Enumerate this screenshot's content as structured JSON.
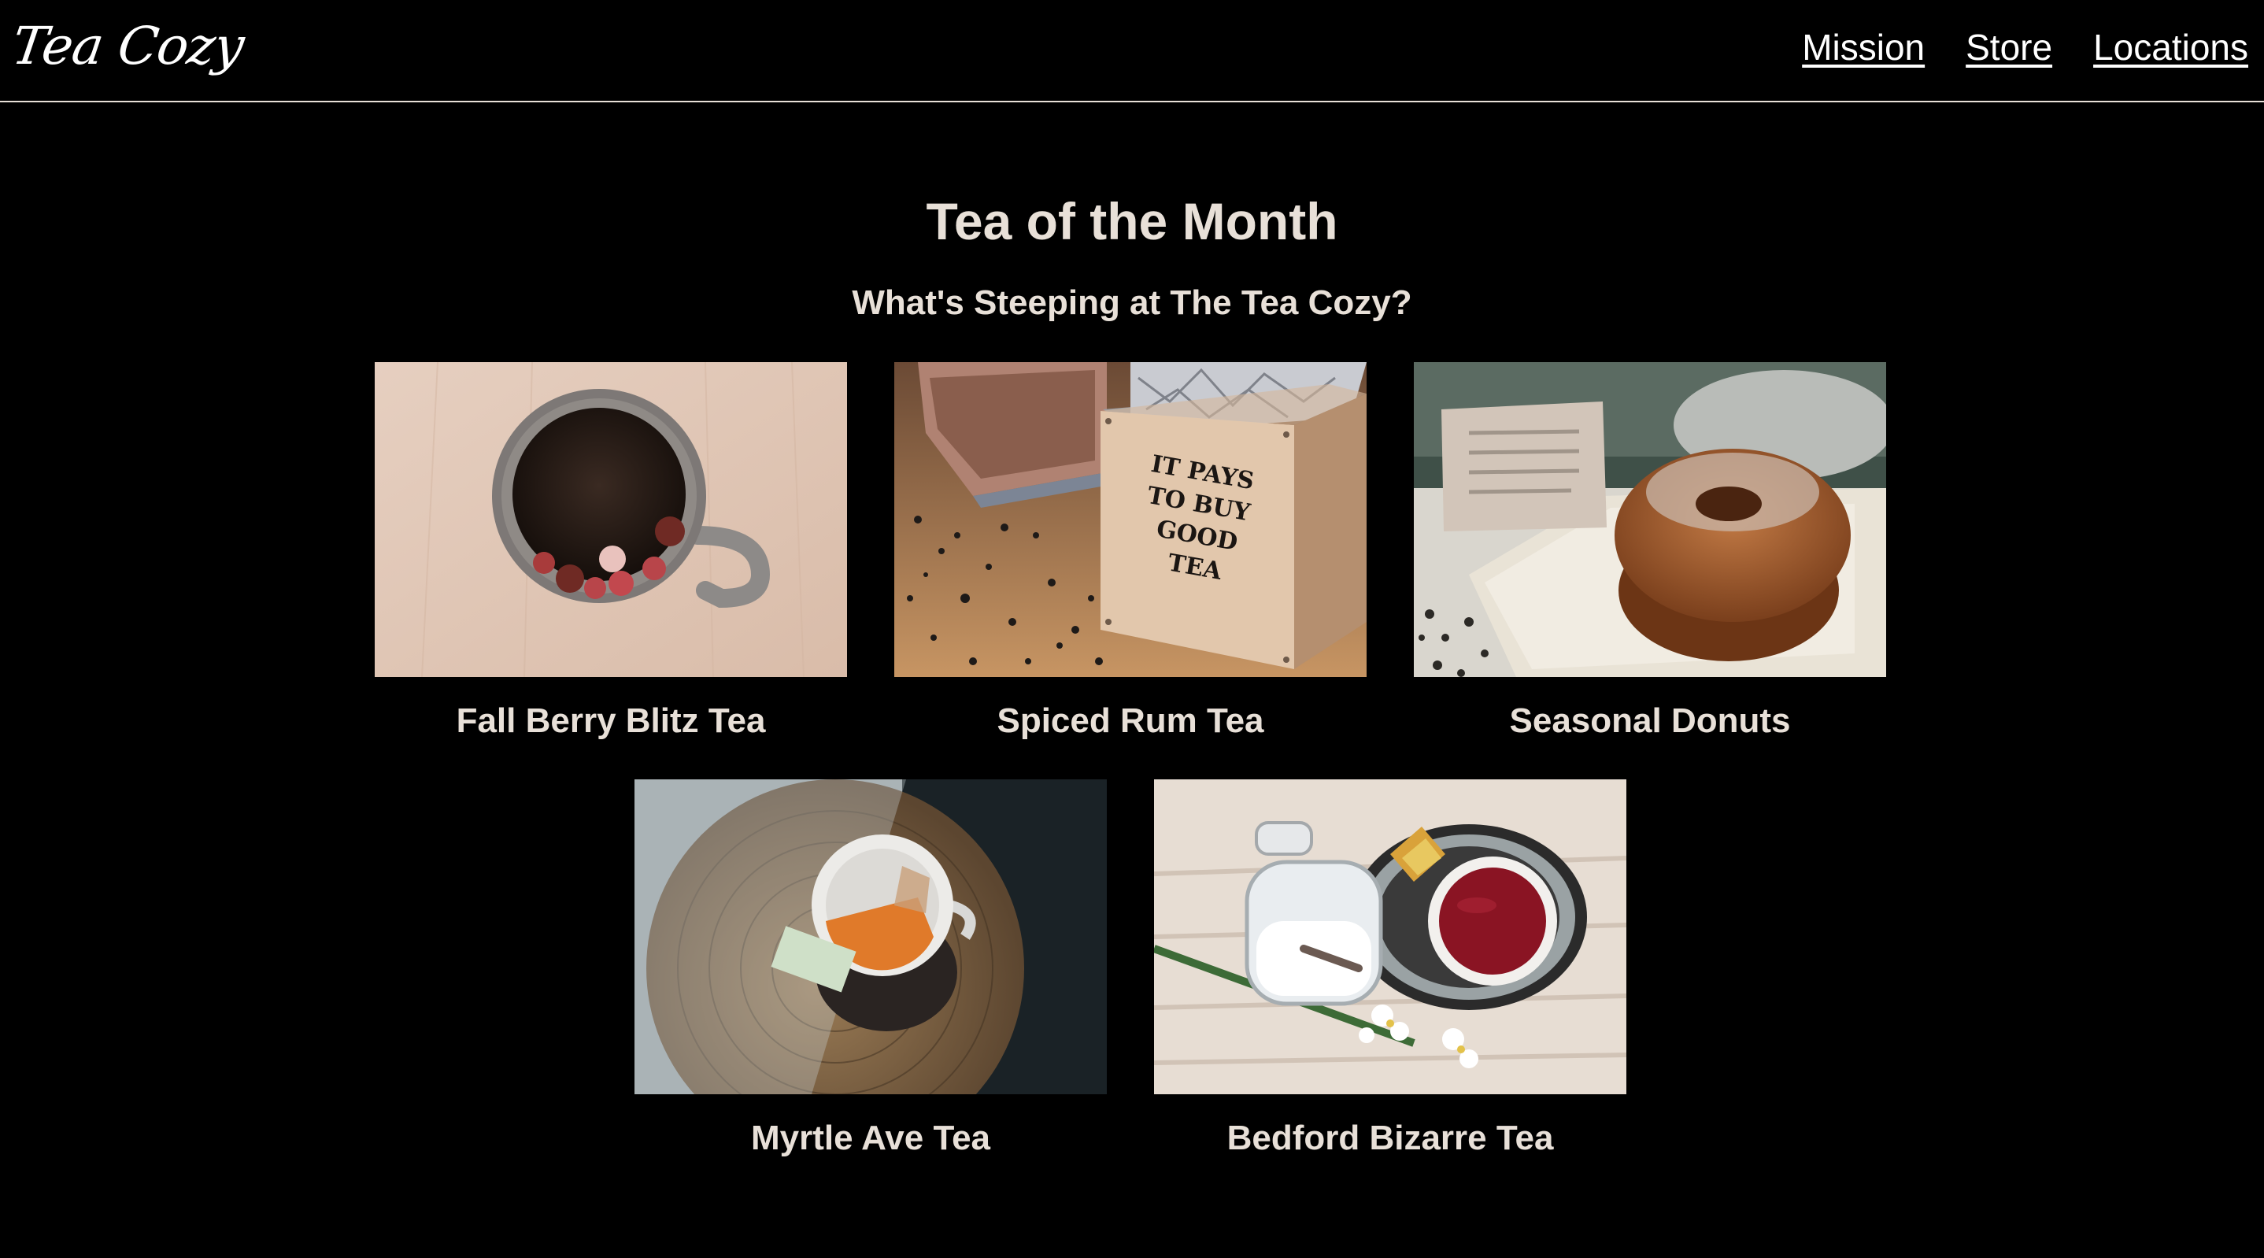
{
  "brand": {
    "logo_text": "Tea Cozy"
  },
  "nav": {
    "items": [
      {
        "label": "Mission"
      },
      {
        "label": "Store"
      },
      {
        "label": "Locations"
      }
    ]
  },
  "main": {
    "title": "Tea of the Month",
    "subtitle": "What's Steeping at The Tea Cozy?",
    "products": [
      {
        "name": "Fall Berry Blitz Tea"
      },
      {
        "name": "Spiced Rum Tea",
        "box_text": "IT PAYS TO BUY GOOD TEA"
      },
      {
        "name": "Seasonal Donuts"
      },
      {
        "name": "Myrtle Ave Tea"
      },
      {
        "name": "Bedford Bizarre Tea"
      }
    ]
  },
  "colors": {
    "background": "#000000",
    "text": "#e8e0d8",
    "nav_link": "#ffffff"
  }
}
